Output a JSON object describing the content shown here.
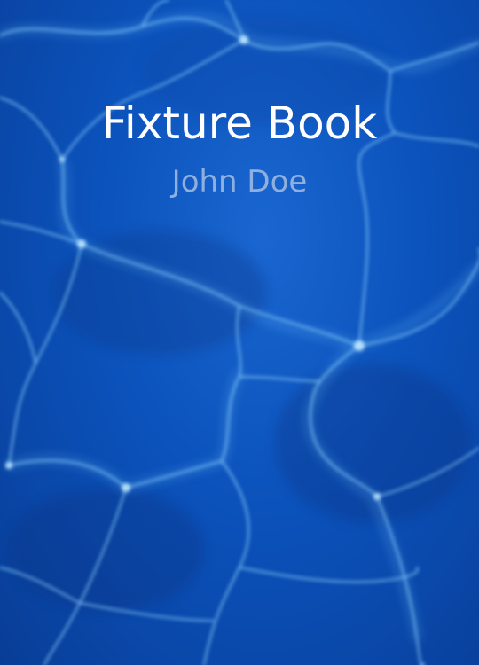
{
  "cover": {
    "title": "Fixture Book",
    "author": "John Doe",
    "background_image": "water-caustics-pattern"
  },
  "colors": {
    "background": "#0a4fb5",
    "title": "#ffffff",
    "author": "#8fb0df",
    "caustic_light": "#8fd3ff"
  }
}
